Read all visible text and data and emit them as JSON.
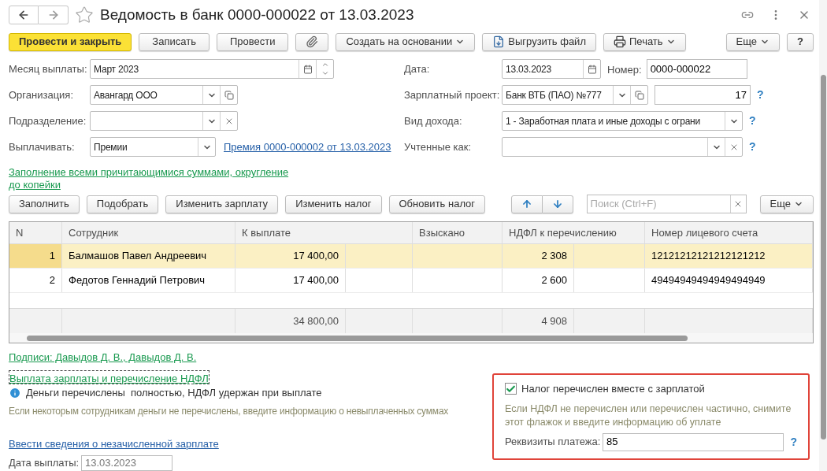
{
  "window": {
    "title": "Ведомость в банк 0000-000022 от 13.03.2023",
    "favorite": false
  },
  "toolbar": {
    "buttons": [
      {
        "label": "Провести и закрыть",
        "kind": "primary"
      },
      {
        "label": "Записать",
        "kind": "plain"
      },
      {
        "label": "Провести",
        "kind": "plain"
      },
      {
        "kind": "attach"
      },
      {
        "label": "Создать на основании",
        "kind": "menu"
      },
      {
        "label": "Выгрузить файл",
        "kind": "export"
      },
      {
        "label": "Печать",
        "kind": "print"
      }
    ],
    "more": "Еще",
    "help": "?"
  },
  "form": {
    "left": [
      {
        "label": "Месяц выплаты:",
        "value": "Март 2023",
        "kind": "month"
      },
      {
        "label": "Организация:",
        "value": "Авангард ООО",
        "kind": "open"
      },
      {
        "label": "Подразделение:",
        "kind": "clear"
      },
      {
        "label": "Выплачивать:",
        "value": "Премии",
        "kind": "select",
        "link": "Премия 0000-000002 от 13.03.2023"
      }
    ],
    "right": [
      {
        "label": "Дата:",
        "value": "13.03.2023",
        "kind": "date",
        "extra_label": "Номер:",
        "extra_value": "0000-000022"
      },
      {
        "label": "Зарплатный проект:",
        "value": "Банк ВТБ (ПАО) №777",
        "kind": "open",
        "extra_value": "17",
        "help": "?"
      },
      {
        "label": "Вид дохода:",
        "value": "1 - Заработная плата и иные доходы с ограни",
        "kind": "select",
        "help": "?"
      },
      {
        "label": "Учтенные как:",
        "kind": "clear",
        "help": "?"
      }
    ],
    "fill_link": "Заполнение всеми причитающимися суммами, округление до копейки"
  },
  "table_toolbar": {
    "buttons": [
      "Заполнить",
      "Подобрать",
      "Изменить зарплату",
      "Изменить налог",
      "Обновить налог"
    ],
    "search": {
      "placeholder": "Поиск (Ctrl+F)"
    },
    "more": "Еще"
  },
  "table": {
    "columns": [
      "N",
      "Сотрудник",
      "К выплате",
      "Взыскано",
      "НДФЛ к перечислению",
      "Номер лицевого счета"
    ],
    "rows": [
      {
        "n": "1",
        "employee": "Балмашов Павел Андреевич",
        "pay": "17 400,00",
        "withheld": "",
        "tax": "2 308",
        "account": "12121212121212121212",
        "selected": true
      },
      {
        "n": "2",
        "employee": "Федотов Геннадий Петрович",
        "pay": "17 400,00",
        "withheld": "",
        "tax": "2 600",
        "account": "49494949494949494949",
        "selected": false
      }
    ],
    "totals": {
      "pay": "34 800,00",
      "tax": "4 908"
    }
  },
  "signatures_link": "Подписи: Давыдов Д. В., Давыдов Д. В.",
  "payment_section": {
    "title": "Выплата зарплаты и перечисление НДФЛ",
    "status": "Деньги перечислены  полностью, НДФЛ удержан при выплате",
    "hint": "Если некоторым сотрудникам деньги не перечислены, введите информацию о невыплаченных суммах",
    "link": "Ввести сведения о незачисленной зарплате",
    "date_label": "Дата выплаты:",
    "date_value": "13.03.2023"
  },
  "tax_panel": {
    "checkbox": {
      "label": "Налог перечислен вместе с зарплатой",
      "checked": true
    },
    "hint": "Если НДФЛ не перечислен или перечислен частично, снимите этот флажок и введите информацию об уплате",
    "field_label": "Реквизиты платежа:",
    "field_value": "85",
    "help": "?"
  }
}
